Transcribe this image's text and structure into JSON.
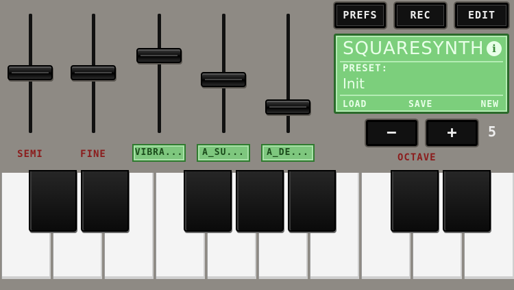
{
  "sliders": [
    {
      "label": "SEMI",
      "level": 0.5
    },
    {
      "label": "FINE",
      "level": 0.5
    },
    {
      "label": "VIBRA...",
      "level": 0.66
    },
    {
      "label": "A_SU...",
      "level": 0.45
    },
    {
      "label": "A_DE...",
      "level": 0.2
    }
  ],
  "toolbar": {
    "prefs": "PREFS",
    "rec": "REC",
    "edit": "EDIT"
  },
  "screen": {
    "title": "SQUARESYNTH",
    "info_icon": "i",
    "preset_label": "PRESET:",
    "preset_value": "Init",
    "load": "LOAD",
    "save": "SAVE",
    "new": "NEW"
  },
  "octave": {
    "minus": "−",
    "plus": "+",
    "value": "5",
    "label": "OCTAVE"
  },
  "colors": {
    "screen": "#7ccf7c",
    "label_red": "#8b1c1c",
    "body": "#8e8a84"
  }
}
